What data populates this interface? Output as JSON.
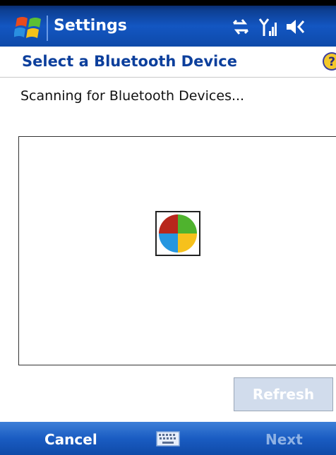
{
  "titlebar": {
    "title": "Settings",
    "icons": [
      "start-flag-icon",
      "connectivity-icon",
      "signal-icon",
      "volume-icon"
    ]
  },
  "header": {
    "title": "Select a Bluetooth Device",
    "help_icon": "help-icon"
  },
  "status": {
    "text": "Scanning for Bluetooth Devices..."
  },
  "device_list": {
    "items": [],
    "busy_icon": "busy-windows-flag-icon"
  },
  "refresh_button": {
    "label": "Refresh",
    "enabled": false
  },
  "softkeys": {
    "left_label": "Cancel",
    "right_label": "Next",
    "right_enabled": false,
    "center_icon": "keyboard-icon"
  },
  "colors": {
    "titlebar": "#1356c2",
    "header_text": "#0c3f9c",
    "softkey_bar": "#1a5cc2",
    "disabled_button": "#d1dcec",
    "disabled_softkey_text": "#8fb2e4"
  }
}
